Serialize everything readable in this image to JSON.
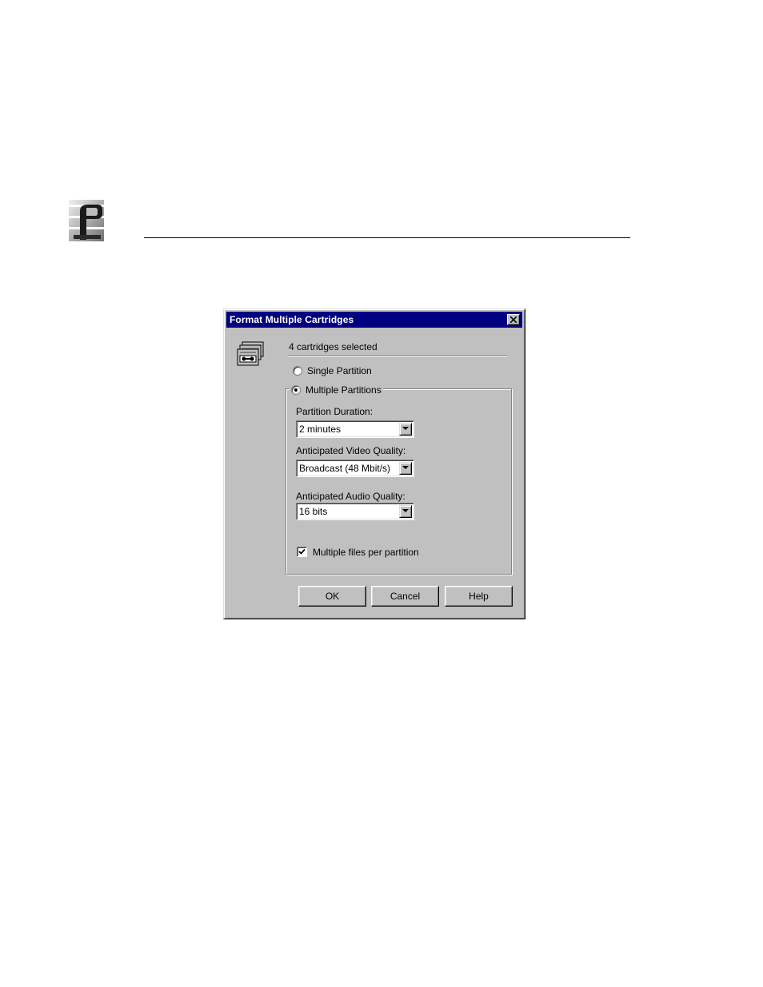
{
  "dialog": {
    "title": "Format Multiple Cartridges",
    "close_icon": "close-icon",
    "header_icon": "cartridges-icon",
    "selected_text": "4 cartridges selected",
    "single_partition_label": "Single Partition",
    "single_partition_selected": false,
    "multiple_partitions_label": "Multiple Partitions",
    "multiple_partitions_selected": true,
    "partition_duration": {
      "label": "Partition Duration:",
      "value": "2 minutes"
    },
    "video_quality": {
      "label": "Anticipated Video Quality:",
      "value": "Broadcast (48 Mbit/s)"
    },
    "audio_quality": {
      "label": "Anticipated Audio Quality:",
      "value": "16 bits"
    },
    "multiple_files": {
      "label": "Multiple files per partition",
      "checked": true
    },
    "buttons": {
      "ok": "OK",
      "cancel": "Cancel",
      "help": "Help"
    }
  },
  "page": {
    "logo_icon": "company-logo-icon"
  },
  "colors": {
    "titlebar": "#000080",
    "dialog_face": "#c0c0c0",
    "title_text": "#ffffff"
  }
}
